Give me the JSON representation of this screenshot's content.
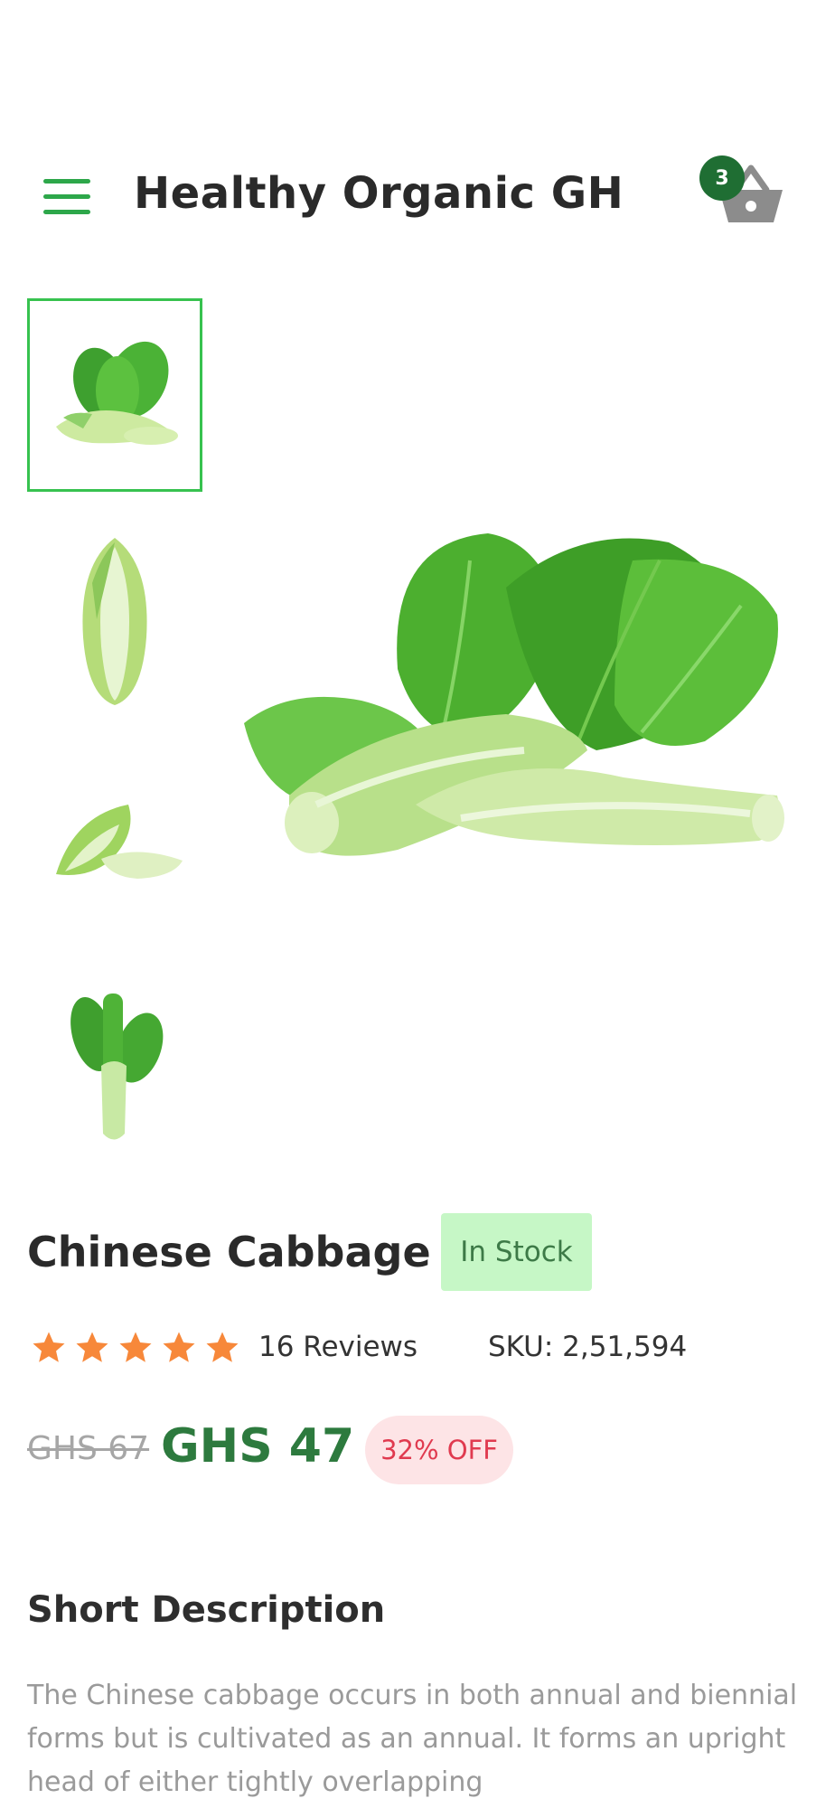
{
  "header": {
    "title": "Healthy Organic GH",
    "cart_count": "3",
    "menu_icon": "hamburger-menu-icon",
    "cart_icon": "basket-icon"
  },
  "gallery": {
    "thumbnails": [
      {
        "label": "chinese-cabbage-bunch",
        "selected": true
      },
      {
        "label": "chinese-cabbage-head",
        "selected": false
      },
      {
        "label": "chinese-cabbage-halved",
        "selected": false
      },
      {
        "label": "chinese-cabbage-stalk",
        "selected": false
      }
    ]
  },
  "product": {
    "name": "Chinese Cabbage",
    "stock_status": "In Stock",
    "rating": 5,
    "reviews_label": "16 Reviews",
    "sku_label": "SKU: 2,51,594",
    "old_price": "GHS 67",
    "price": "GHS 47",
    "discount": "32% OFF"
  },
  "description": {
    "title": "Short Description",
    "text": "The Chinese cabbage occurs in both annual and biennial forms but is cultivated as an annual. It forms an upright head of either tightly overlapping"
  },
  "colors": {
    "accent_green": "#2da74a",
    "price_green": "#2d7a3e",
    "stock_bg": "#c6f7c6",
    "discount_bg": "#fde4e6",
    "discount_text": "#e03a4f",
    "star": "#f7883a"
  }
}
